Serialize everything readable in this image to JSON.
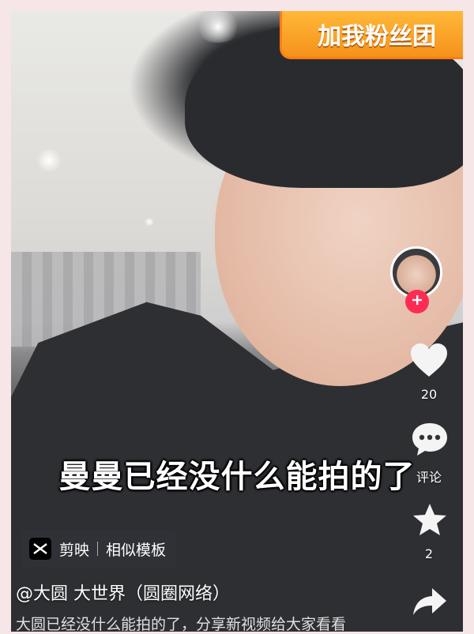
{
  "overlay": {
    "banner_text": "加我粉丝团",
    "caption": "曼曼已经没什么能拍的了"
  },
  "template": {
    "app_name": "剪映",
    "label": "相似模板"
  },
  "video": {
    "author": "@大圆   大世界（圆圈网络）",
    "description": "大圆已经没什么能拍的了，分享新视频给大家看看"
  },
  "sidebar": {
    "like_count": "20",
    "comment_label": "评论",
    "favorite_count": "2"
  },
  "colors": {
    "accent": "#fe2c55",
    "banner": "#f5921b"
  }
}
